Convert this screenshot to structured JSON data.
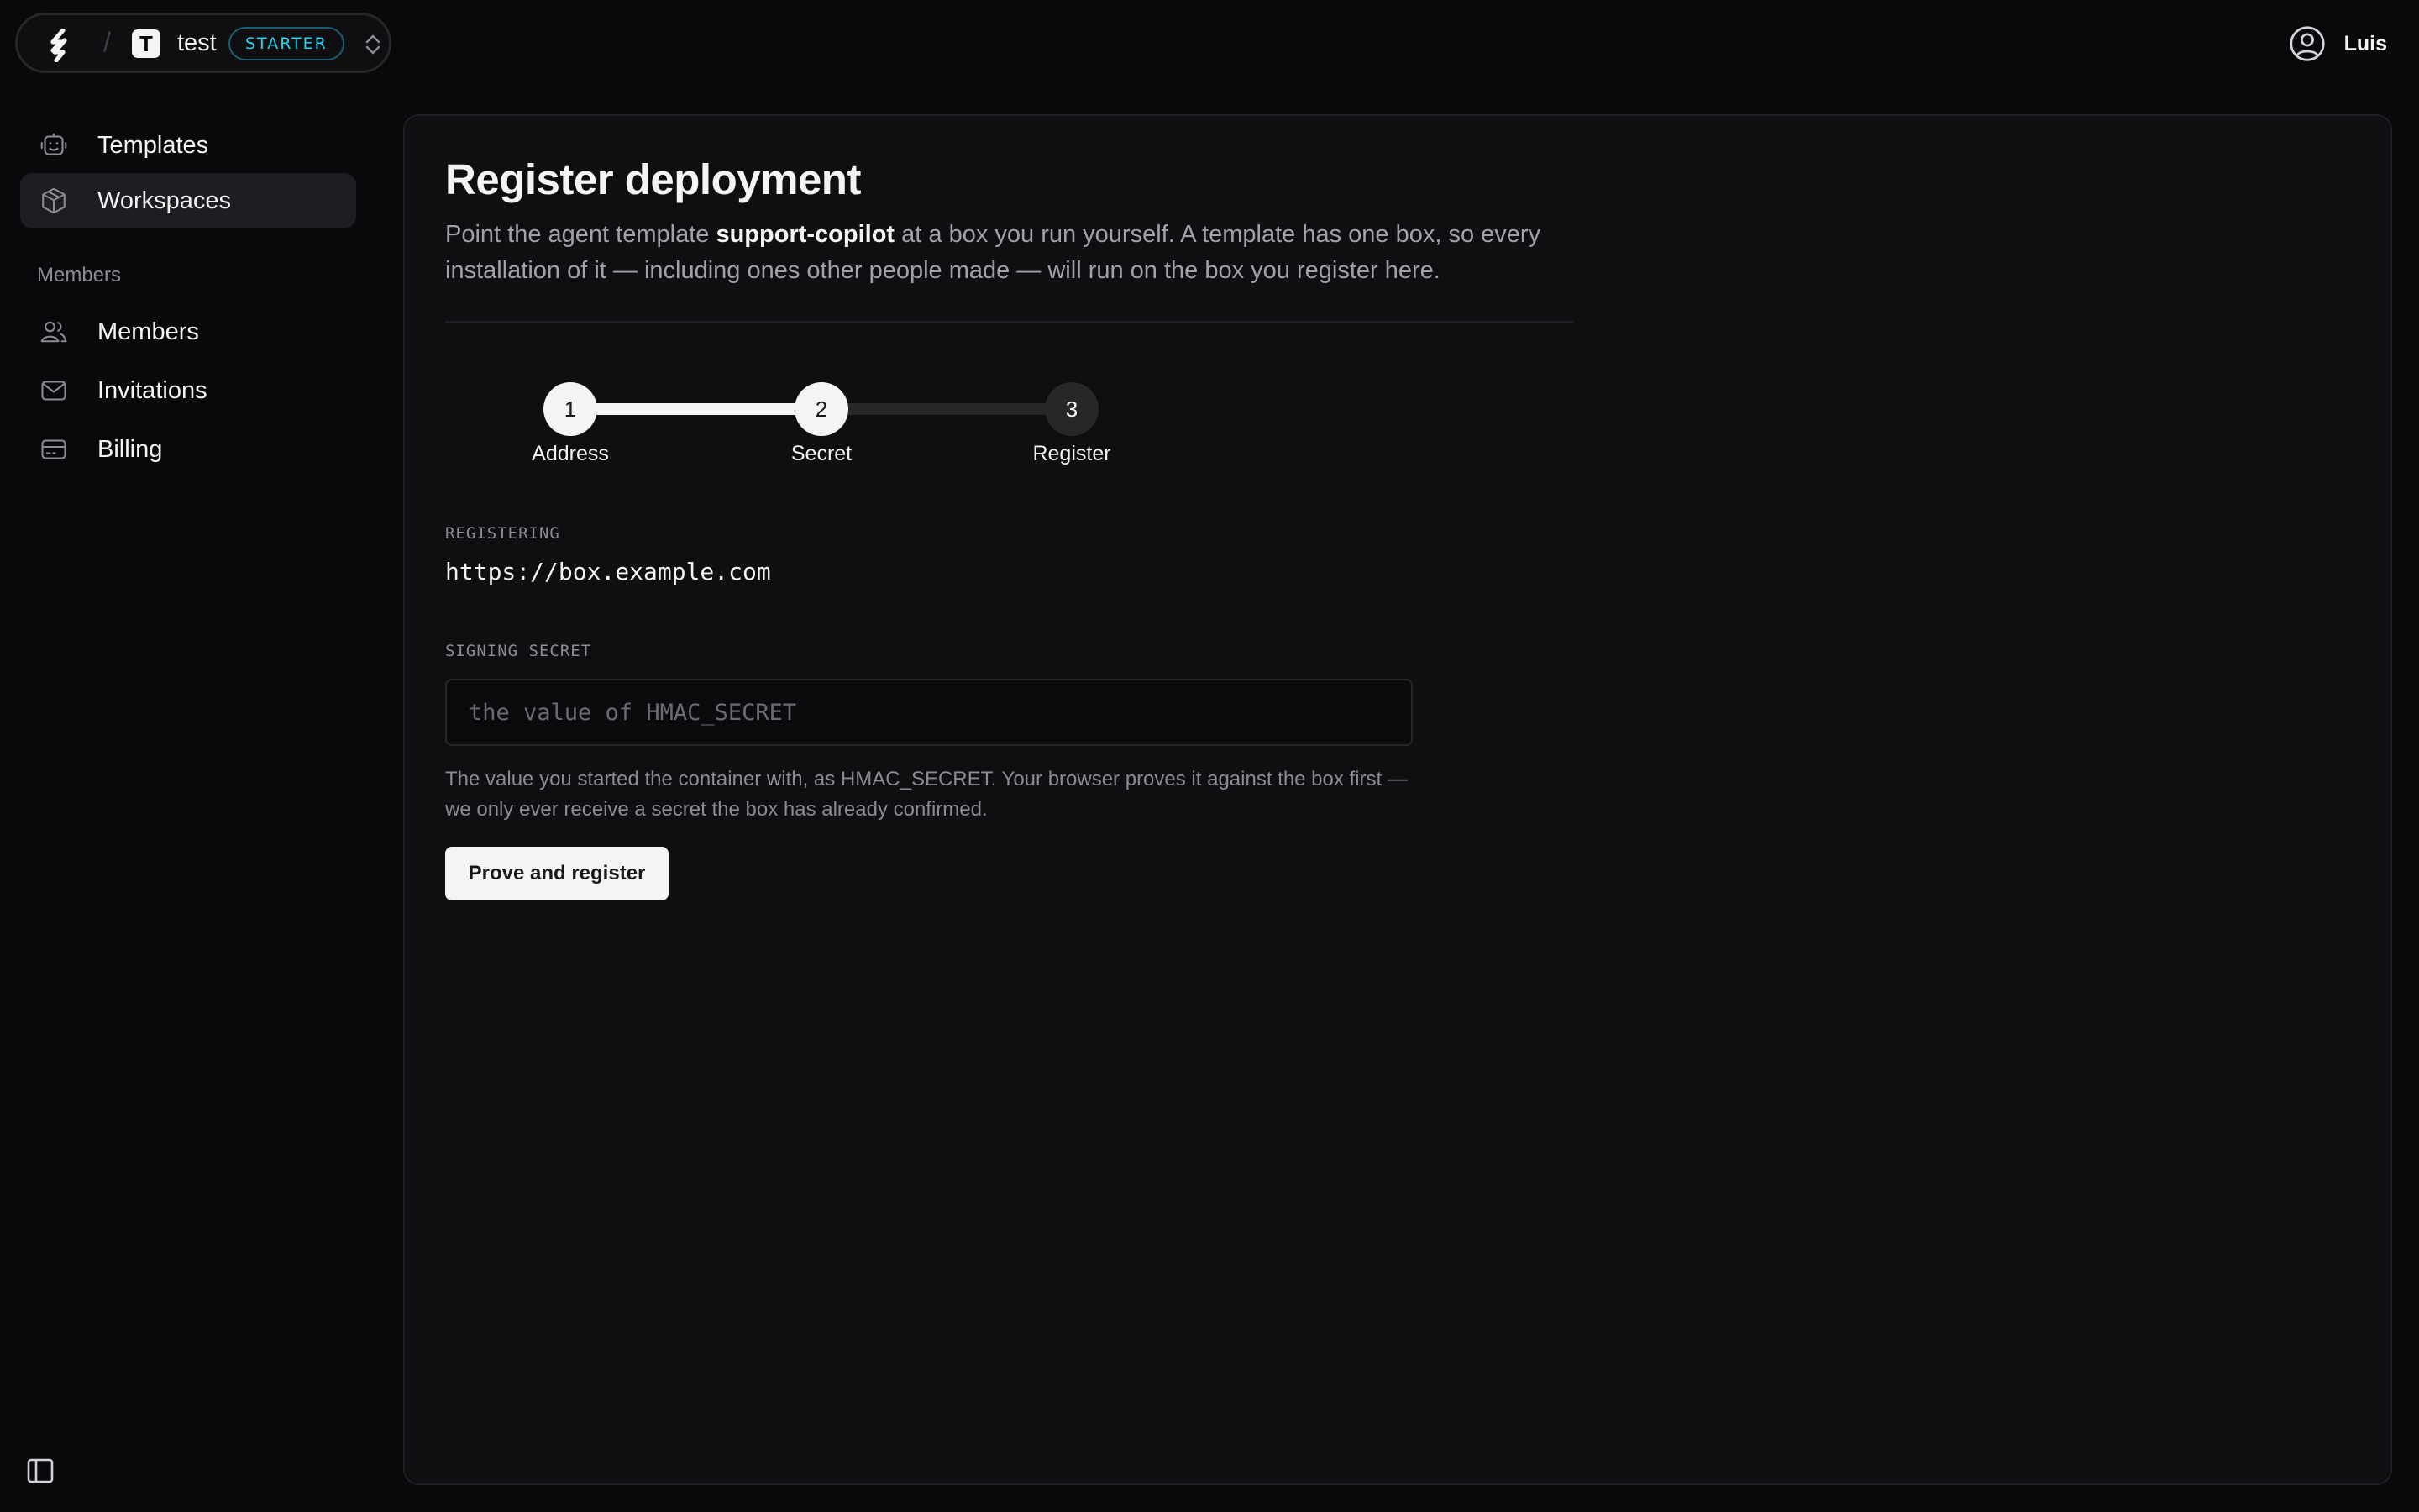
{
  "workspace": {
    "initial": "T",
    "name": "test",
    "plan": "STARTER"
  },
  "user": {
    "name": "Luis"
  },
  "sidebar": {
    "items": [
      {
        "label": "Templates",
        "icon": "robot-icon"
      },
      {
        "label": "Workspaces",
        "icon": "cube-icon",
        "active": true
      }
    ],
    "members_section": {
      "title": "Members",
      "items": [
        {
          "label": "Members",
          "icon": "users-icon"
        },
        {
          "label": "Invitations",
          "icon": "mail-icon"
        },
        {
          "label": "Billing",
          "icon": "card-icon"
        }
      ]
    }
  },
  "page": {
    "title": "Register deployment",
    "desc_prefix": "Point the agent template ",
    "template_name": "support-copilot",
    "desc_suffix": " at a box you run yourself. A template has one box, so every installation of it — including ones other people made — will run on the box you register here."
  },
  "stepper": {
    "current_step": 2,
    "steps": [
      {
        "number": "1",
        "label": "Address"
      },
      {
        "number": "2",
        "label": "Secret"
      },
      {
        "number": "3",
        "label": "Register"
      }
    ]
  },
  "form": {
    "registering_label": "REGISTERING",
    "registering_value": "https://box.example.com",
    "secret_label": "SIGNING SECRET",
    "secret_placeholder": "the value of HMAC_SECRET",
    "secret_value": "",
    "help_text": "The value you started the container with, as HMAC_SECRET. Your browser proves it against the box first — we only ever receive a secret the box has already confirmed.",
    "submit_label": "Prove and register"
  },
  "colors": {
    "background": "#09090b",
    "card": "#0f0f11",
    "plan_accent": "#22d3ee",
    "primary": "#f4f4f5"
  }
}
